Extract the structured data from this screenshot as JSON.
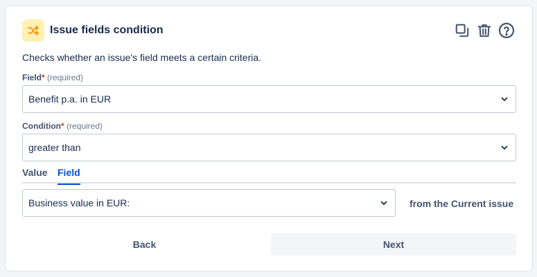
{
  "header": {
    "title": "Issue fields condition",
    "icon": "shuffle-icon",
    "accent": "#ff8b00",
    "actions": [
      "copy-icon",
      "trash-icon",
      "help-icon"
    ]
  },
  "description": "Checks whether an issue's field meets a certain criteria.",
  "field": {
    "label": "Field",
    "required_mark": "*",
    "required_text": "(required)",
    "value": "Benefit p.a. in EUR"
  },
  "condition": {
    "label": "Condition",
    "required_mark": "*",
    "required_text": "(required)",
    "value": "greater than"
  },
  "tabs": [
    {
      "label": "Value",
      "active": false
    },
    {
      "label": "Field",
      "active": true
    }
  ],
  "compare_field": {
    "value": "Business value in EUR:",
    "suffix": "from the Current issue"
  },
  "buttons": {
    "back": "Back",
    "next": "Next"
  }
}
